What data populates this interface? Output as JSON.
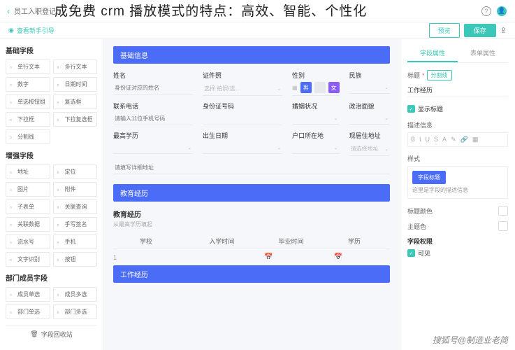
{
  "overlay_title": "成免费 crm 播放模式的特点：高效、智能、个性化",
  "header": {
    "back": "‹",
    "breadcrumb": "员工入职登记",
    "help": "?",
    "guide_text": "查看新手引导",
    "preview_btn": "预览",
    "save_btn": "保存"
  },
  "sidebar": {
    "sections": [
      {
        "title": "基础字段",
        "items": [
          "单行文本",
          "多行文本",
          "数字",
          "日期时间",
          "单选按钮组",
          "复选框",
          "下拉框",
          "下拉复选框",
          "分割线"
        ]
      },
      {
        "title": "增强字段",
        "items": [
          "地址",
          "定位",
          "图片",
          "附件",
          "子表单",
          "关联查询",
          "关联数据",
          "手写签名",
          "流水号",
          "手机",
          "文字识别",
          "按钮"
        ]
      },
      {
        "title": "部门成员字段",
        "items": [
          "成员单选",
          "成员多选",
          "部门单选",
          "部门多选"
        ]
      }
    ],
    "recycle": "字段回收站"
  },
  "canvas": {
    "sections": [
      {
        "header": "基础信息",
        "fields": [
          {
            "label": "姓名",
            "type": "input",
            "placeholder": "身份证对应的姓名"
          },
          {
            "label": "证件照",
            "type": "select",
            "placeholder": "选择 拍照/选…"
          },
          {
            "label": "性别",
            "type": "radio",
            "options": [
              "男",
              "",
              "女"
            ]
          },
          {
            "label": "民族",
            "type": "select",
            "placeholder": ""
          },
          {
            "label": "联系电话",
            "type": "input",
            "placeholder": "请输入11位手机号码"
          },
          {
            "label": "身份证号码",
            "type": "input",
            "placeholder": ""
          },
          {
            "label": "婚姻状况",
            "type": "select",
            "placeholder": ""
          },
          {
            "label": "政治面貌",
            "type": "select",
            "placeholder": ""
          },
          {
            "label": "最高学历",
            "type": "select",
            "placeholder": ""
          },
          {
            "label": "出生日期",
            "type": "select",
            "placeholder": ""
          },
          {
            "label": "户口所在地",
            "type": "select",
            "placeholder": ""
          },
          {
            "label": "现居住地址",
            "type": "select",
            "placeholder": "请选择地址"
          },
          {
            "label": "",
            "type": "input",
            "placeholder": "请填写详细地址",
            "span": 4
          }
        ]
      },
      {
        "header": "教育经历",
        "table": {
          "title": "教育经历",
          "subtitle": "从最高学历填起",
          "columns": [
            "",
            "学校",
            "入学时间",
            "毕业时间",
            "学历"
          ],
          "rows": [
            [
              "1",
              "",
              "",
              "",
              ""
            ]
          ]
        }
      },
      {
        "header": "工作经历"
      }
    ]
  },
  "right": {
    "tabs": [
      "字段属性",
      "表单属性"
    ],
    "title_label": "标题",
    "split_btn": "分割线",
    "title_value": "工作经历",
    "show_title": "显示标题",
    "desc_label": "描述信息",
    "style_label": "样式",
    "style_preview": "字段标题",
    "style_desc": "这里是字段的描述信息",
    "title_color": "标题颜色",
    "theme_color": "主题色",
    "perm_label": "字段权限",
    "visible": "可见"
  },
  "watermark": "搜狐号@制造业老简"
}
